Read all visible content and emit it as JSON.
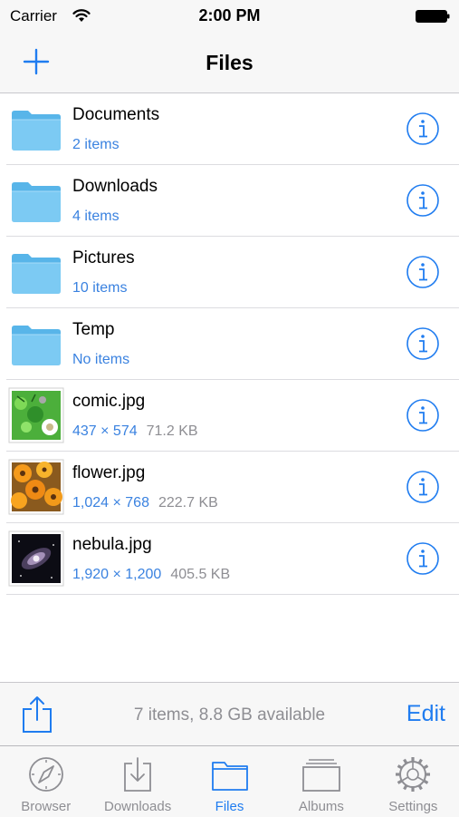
{
  "status_bar": {
    "carrier": "Carrier",
    "time": "2:00 PM"
  },
  "nav": {
    "title": "Files",
    "add_icon": "plus-icon"
  },
  "files": [
    {
      "name": "Documents",
      "kind": "folder",
      "meta_primary": "2 items",
      "meta_secondary": ""
    },
    {
      "name": "Downloads",
      "kind": "folder",
      "meta_primary": "4 items",
      "meta_secondary": ""
    },
    {
      "name": "Pictures",
      "kind": "folder",
      "meta_primary": "10 items",
      "meta_secondary": ""
    },
    {
      "name": "Temp",
      "kind": "folder",
      "meta_primary": "No items",
      "meta_secondary": ""
    },
    {
      "name": "comic.jpg",
      "kind": "image-comic",
      "meta_primary": "437 × 574",
      "meta_secondary": "71.2 KB"
    },
    {
      "name": "flower.jpg",
      "kind": "image-flower",
      "meta_primary": "1,024 × 768",
      "meta_secondary": "222.7 KB"
    },
    {
      "name": "nebula.jpg",
      "kind": "image-nebula",
      "meta_primary": "1,920 × 1,200",
      "meta_secondary": "405.5 KB"
    }
  ],
  "toolbar": {
    "status": "7 items, 8.8 GB available",
    "edit_label": "Edit",
    "share_icon": "share-icon"
  },
  "tabs": [
    {
      "label": "Browser",
      "icon": "compass-icon",
      "active": false
    },
    {
      "label": "Downloads",
      "icon": "download-icon",
      "active": false
    },
    {
      "label": "Files",
      "icon": "folder-icon",
      "active": true
    },
    {
      "label": "Albums",
      "icon": "albums-icon",
      "active": false
    },
    {
      "label": "Settings",
      "icon": "gear-icon",
      "active": false
    }
  ],
  "colors": {
    "accent": "#1f7cf0",
    "folder": "#6cc4f2",
    "secondary_text": "#8e8e93"
  }
}
